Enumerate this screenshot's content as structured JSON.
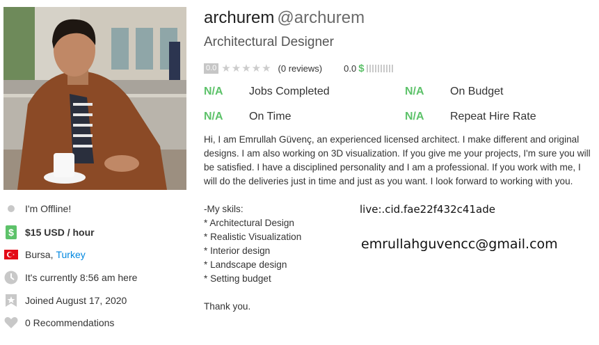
{
  "profile": {
    "username": "archurem",
    "handle": "@archurem",
    "headline": "Architectural Designer",
    "photo_alt": "Profile photo"
  },
  "rating": {
    "score": "0.0",
    "stars": "★★★★★",
    "reviews": "(0 reviews)",
    "earnings_score": "0.0",
    "currency_symbol": "$"
  },
  "stats": {
    "jobs_completed": {
      "value": "N/A",
      "label": "Jobs Completed"
    },
    "on_budget": {
      "value": "N/A",
      "label": "On Budget"
    },
    "on_time": {
      "value": "N/A",
      "label": "On Time"
    },
    "repeat_hire": {
      "value": "N/A",
      "label": "Repeat Hire Rate"
    }
  },
  "about": {
    "intro": "Hi, I am Emrullah Güvenç, an experienced licensed architect. I make different and original designs. I am also working on 3D visualization. If you give me your projects, I'm sure you will be satisfied. I have a disciplined personality and I am a professional. If you work with me, I will do the deliveries just in time and just as you want. I look forward to working with you.",
    "skills_header": "-My skils:",
    "skills": [
      "* Architectural Design",
      "* Realistic Visualization",
      "* Interior design",
      "* Landscape design",
      "* Setting budget"
    ],
    "closing": "Thank you."
  },
  "overlay_text": {
    "live_id": "live:.cid.fae22f432c41ade",
    "email": "emrullahguvencc@gmail.com"
  },
  "sidebar": {
    "status": "I'm Offline!",
    "rate": "$15 USD / hour",
    "city": "Bursa, ",
    "country": "Turkey",
    "local_time": "It's currently 8:56 am here",
    "joined": "Joined August 17, 2020",
    "recommendations": "0 Recommendations"
  },
  "colors": {
    "accent_green": "#5dc26a",
    "link_blue": "#0087e0",
    "icon_gray": "#c8c8c8"
  },
  "icons": [
    "status-dot-icon",
    "dollar-icon",
    "turkey-flag-icon",
    "clock-icon",
    "joined-badge-icon",
    "heart-icon",
    "star-icon"
  ]
}
